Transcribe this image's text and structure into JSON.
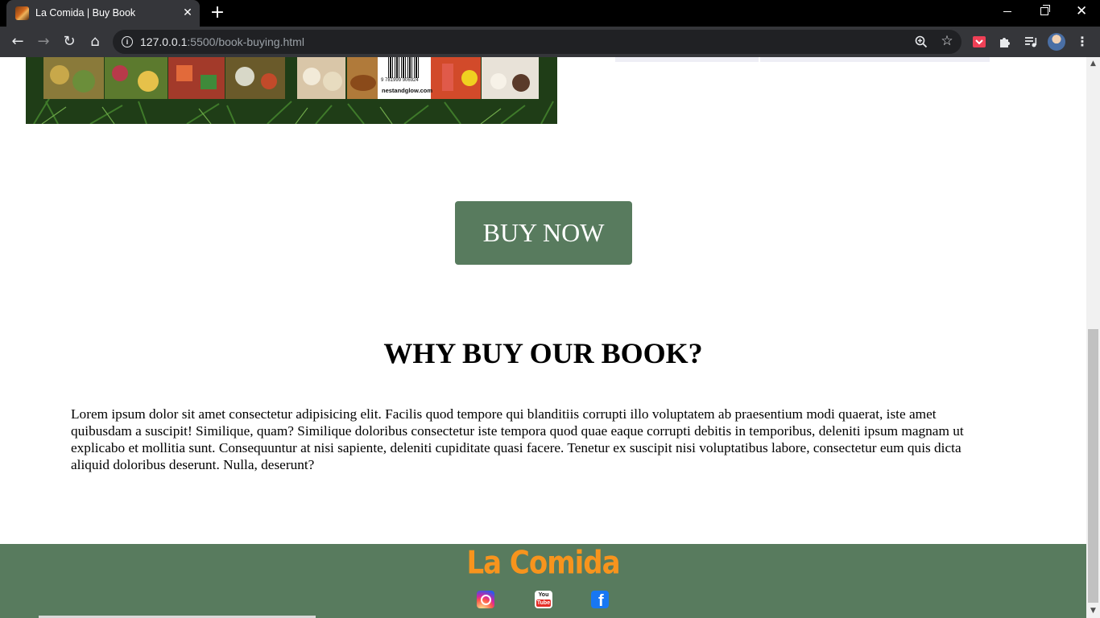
{
  "browser": {
    "tab_title": "La Comida | Buy Book",
    "tab_close": "✕",
    "new_tab": "+",
    "url_host": "127.0.0.1",
    "url_rest": ":5500/book-buying.html",
    "info_glyph": "i",
    "back_glyph": "←",
    "forward_glyph": "→",
    "reload_glyph": "↻",
    "home_glyph": "⌂",
    "star_glyph": "☆",
    "menu_glyph": "⋮",
    "close_glyph": "✕",
    "icons": [
      "favicon",
      "info-icon",
      "zoom-icon",
      "star-icon",
      "pocket-icon",
      "puzzle-icon",
      "media-icon",
      "avatar",
      "menu-icon"
    ]
  },
  "book": {
    "barcode_number": "9 781999 906924",
    "publisher_site": "nestandglow.com"
  },
  "purchase": {
    "buy_label": "BUY NOW"
  },
  "why": {
    "heading": "WHY BUY OUR BOOK?",
    "body": "Lorem ipsum dolor sit amet consectetur adipisicing elit. Facilis quod tempore qui blanditiis corrupti illo voluptatem ab praesentium modi quaerat, iste amet quibusdam a suscipit! Similique, quam? Similique doloribus consectetur iste tempora quod quae eaque corrupti debitis in temporibus, deleniti ipsum magnam ut explicabo et mollitia sunt. Consequuntur at nisi sapiente, deleniti cupiditate quasi facere. Tenetur ex suscipit nisi voluptatibus labore, consectetur eum quis dicta aliquid doloribus deserunt. Nulla, deserunt?"
  },
  "footer": {
    "brand": "La Comida",
    "social": [
      {
        "name": "instagram-icon"
      },
      {
        "name": "youtube-icon",
        "top": "You",
        "bottom": "Tube"
      },
      {
        "name": "facebook-icon",
        "glyph": "f"
      }
    ]
  },
  "colors": {
    "brand_green": "#587b5e",
    "brand_orange": "#f7941d",
    "chrome_dark": "#35363a"
  }
}
